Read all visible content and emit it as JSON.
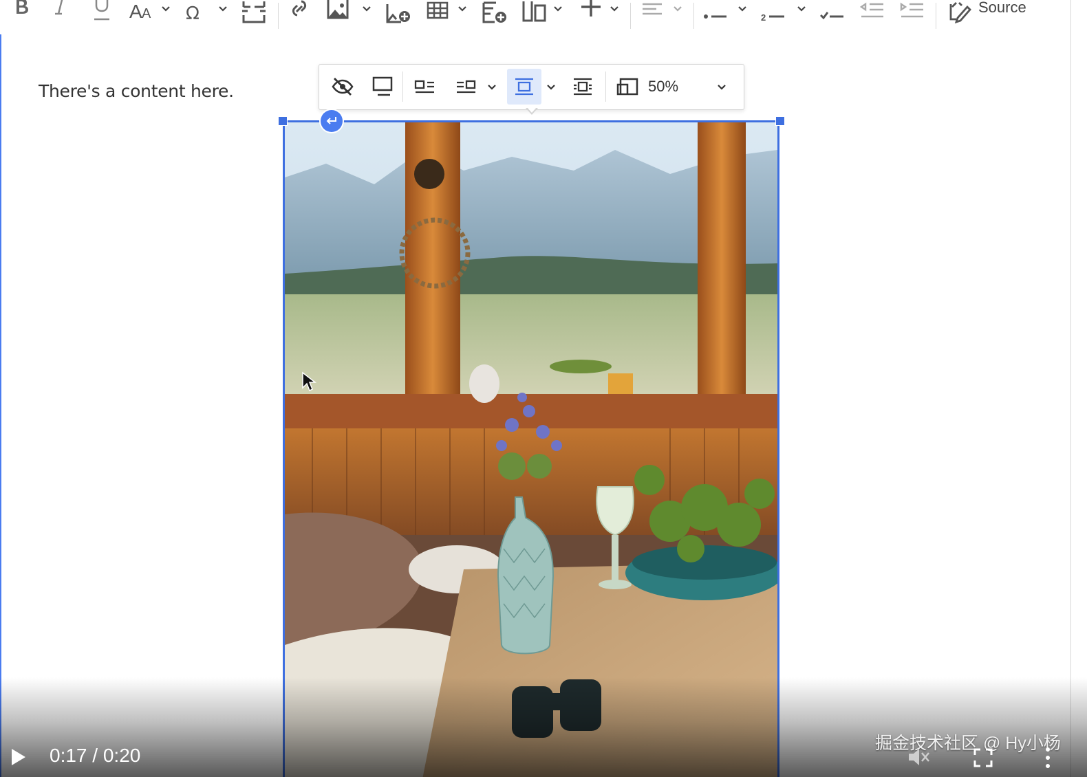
{
  "toolbar": {
    "source_label": "Source",
    "icons": [
      "bold-icon",
      "italic-icon",
      "underline-icon",
      "font-size-icon",
      "special-characters-icon",
      "page-break-icon",
      "link-icon",
      "image-icon",
      "insert-image-icon",
      "table-icon",
      "insert-table-icon",
      "html-embed-icon",
      "insert-icon",
      "align-icon",
      "bulleted-list-icon",
      "numbered-list-icon",
      "todo-list-icon",
      "outdent-icon",
      "indent-icon",
      "source-icon"
    ]
  },
  "editor": {
    "content_text": "There's a content here."
  },
  "image_toolbar": {
    "resize_value": "50%",
    "icons": [
      "toggle-caption-icon",
      "text-alternative-icon",
      "wrap-left-icon",
      "wrap-right-icon",
      "block-center-icon",
      "break-text-icon",
      "resize-icon"
    ],
    "active": "block-center-icon"
  },
  "image": {
    "subject": "rustic cabin interior with window view of mountains, wooden table with vase of lavender"
  },
  "player": {
    "current_time": "0:17",
    "separator": "/",
    "duration": "0:20",
    "watermark": "掘金技术社区 @ Hy小杨"
  },
  "colors": {
    "accent": "#3e6fe0",
    "active_bg": "#dfe9fb",
    "text": "#333333"
  }
}
